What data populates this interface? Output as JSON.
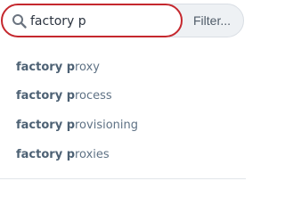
{
  "search": {
    "value": "factory p",
    "filter_label": "Filter..."
  },
  "suggestions": [
    {
      "match": "factory p",
      "rest": "roxy"
    },
    {
      "match": "factory p",
      "rest": "rocess"
    },
    {
      "match": "factory p",
      "rest": "rovisioning"
    },
    {
      "match": "factory p",
      "rest": "roxies"
    }
  ],
  "colors": {
    "focus_border": "#c5282e",
    "suggestion_text": "#5f7285",
    "filter_bg": "#eef1f4"
  },
  "icons": {
    "search": "search-icon"
  }
}
